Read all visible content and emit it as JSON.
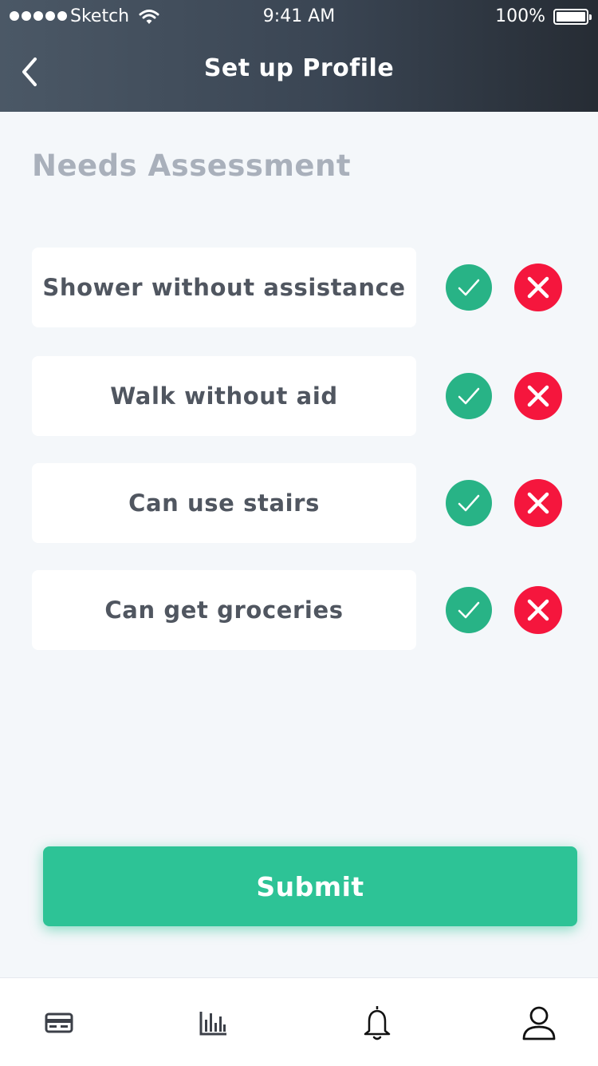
{
  "status_bar": {
    "carrier": "Sketch",
    "time": "9:41 AM",
    "battery": "100%"
  },
  "header": {
    "title": "Set up Profile",
    "back_icon": "chevron-left-icon"
  },
  "section_title": "Needs Assessment",
  "items": [
    {
      "label": "Shower without assistance"
    },
    {
      "label": "Walk without aid"
    },
    {
      "label": "Can use stairs"
    },
    {
      "label": "Can get groceries"
    }
  ],
  "submit_label": "Submit",
  "tab_bar": {
    "tabs": [
      {
        "icon": "card-icon"
      },
      {
        "icon": "bar-chart-icon"
      },
      {
        "icon": "bell-icon"
      },
      {
        "icon": "user-icon"
      }
    ]
  },
  "colors": {
    "yes": "#28b386",
    "no": "#f5163d",
    "accent": "#2dc396",
    "section_title": "#a9b0bb",
    "header_start": "#4b5866",
    "header_end": "#262c34"
  }
}
